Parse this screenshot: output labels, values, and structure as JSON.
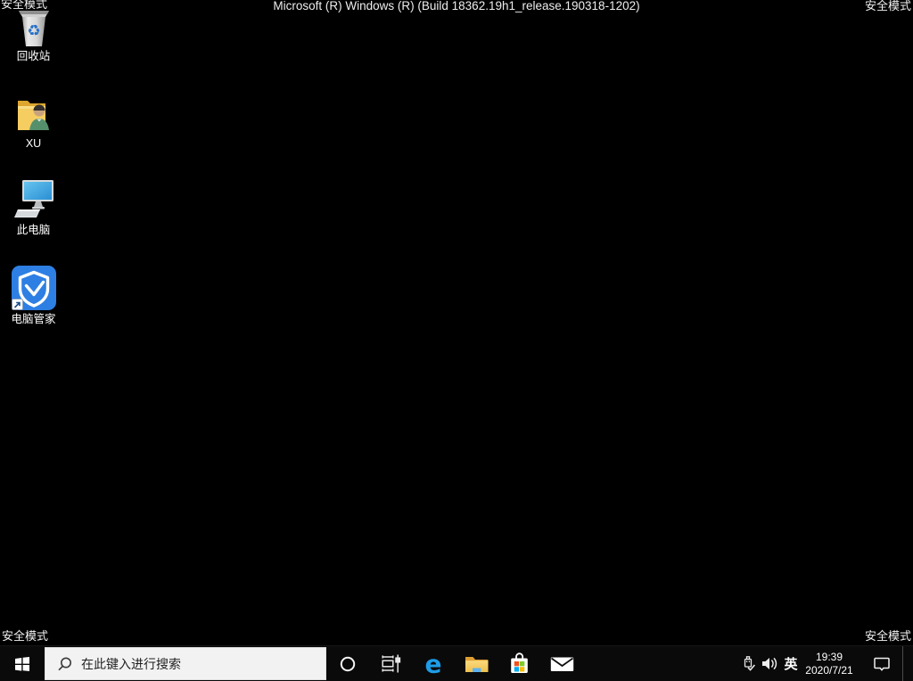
{
  "desktop": {
    "build_text": "Microsoft (R) Windows (R) (Build 18362.19h1_release.190318-1202)",
    "safe_mode_label": "安全模式",
    "icons": [
      {
        "name": "recycle-bin",
        "label": "回收站",
        "icon": "recycle-bin-icon"
      },
      {
        "name": "user-folder",
        "label": "XU",
        "icon": "user-folder-icon"
      },
      {
        "name": "this-pc",
        "label": "此电脑",
        "icon": "computer-icon"
      },
      {
        "name": "pc-manager",
        "label": "电脑管家",
        "icon": "shield-icon"
      }
    ]
  },
  "taskbar": {
    "start": {
      "icon": "windows-logo-icon"
    },
    "search": {
      "placeholder": "在此键入进行搜索",
      "icon": "search-icon"
    },
    "app_buttons": [
      {
        "name": "cortana",
        "icon": "cortana-circle-icon"
      },
      {
        "name": "task-view",
        "icon": "task-view-icon"
      },
      {
        "name": "edge",
        "icon": "edge-icon"
      },
      {
        "name": "file-explorer",
        "icon": "folder-icon"
      },
      {
        "name": "store",
        "icon": "store-bag-icon"
      },
      {
        "name": "mail",
        "icon": "envelope-icon"
      }
    ],
    "tray": {
      "usb_icon": "usb-device-icon",
      "volume_icon": "speaker-icon",
      "ime_label": "英",
      "clock": {
        "time": "19:39",
        "date": "2020/7/21"
      },
      "notification_icon": "action-center-icon"
    }
  },
  "colors": {
    "desktop_bg": "#000000",
    "taskbar_bg": "#0a0a0a",
    "searchbox_bg": "#f2f2f2",
    "edge_blue": "#1e9ce6",
    "pc_manager_blue": "#2e7fe3",
    "screen_blue": "#3aa0dd",
    "folder_yellow": "#f6ce63",
    "recycle_blue": "#2470c8",
    "store_red": "#f1511b",
    "store_green": "#80cc28",
    "store_blue": "#00adef",
    "store_yellow": "#fbbc09"
  }
}
